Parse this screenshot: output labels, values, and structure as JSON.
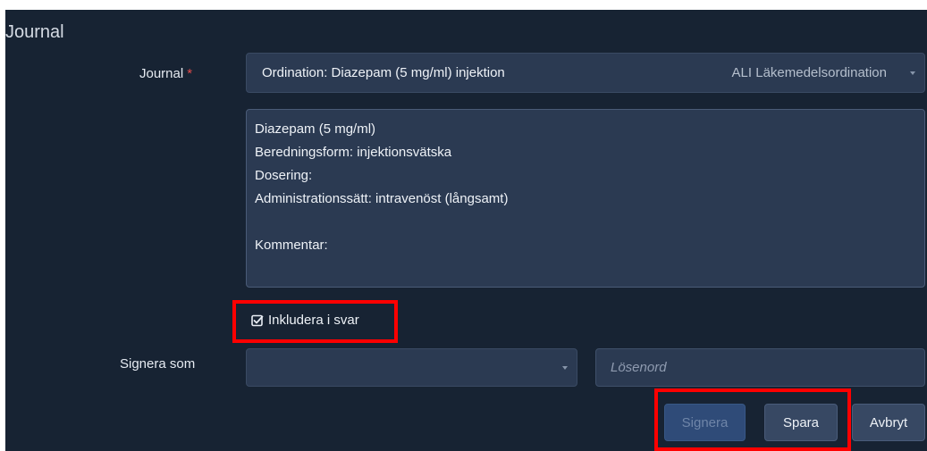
{
  "panel": {
    "title": "Journal"
  },
  "journal_field": {
    "label": "Journal",
    "required_mark": "*",
    "selected_value": "Ordination: Diazepam (5 mg/ml) injektion",
    "selected_type": "ALI Läkemedelsordination"
  },
  "journal_text": {
    "content": "Diazepam (5 mg/ml)\nBeredningsform: injektionsvätska\nDosering:\nAdministrationssätt: intravenöst (långsamt)\n\nKommentar:"
  },
  "include_checkbox": {
    "label": "Inkludera i svar",
    "checked": true
  },
  "sign_as": {
    "label": "Signera som",
    "selected_value": "",
    "password_placeholder": "Lösenord"
  },
  "buttons": {
    "sign_label": "Signera",
    "save_label": "Spara",
    "cancel_label": "Avbryt"
  },
  "colors": {
    "panel_bg": "#172333",
    "field_bg": "#2b3a52",
    "highlight": "#ff0000",
    "required": "#e24b4b"
  }
}
